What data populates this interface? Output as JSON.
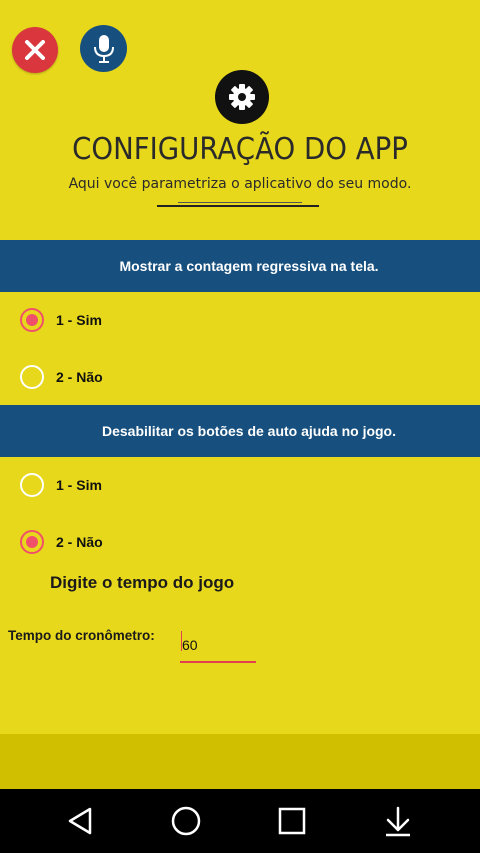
{
  "header": {
    "title": "CONFIGURAÇÃO DO APP",
    "subtitle": "Aqui você parametriza o aplicativo do seu modo."
  },
  "icons": {
    "close": "close-icon",
    "mic": "microphone-icon",
    "settings": "gear-icon"
  },
  "colors": {
    "background": "#e8d81c",
    "section_bar": "#17507e",
    "close_button": "#d9363d",
    "radio_checked": "#f0506a"
  },
  "sections": [
    {
      "heading": "Mostrar a contagem regressiva na tela.",
      "options": [
        {
          "label": "1 - Sim",
          "checked": true
        },
        {
          "label": "2 - Não",
          "checked": false
        }
      ]
    },
    {
      "heading": "Desabilitar os botões de auto ajuda no jogo.",
      "options": [
        {
          "label": "1 - Sim",
          "checked": false
        },
        {
          "label": "2 - Não",
          "checked": true
        }
      ]
    }
  ],
  "timer": {
    "heading": "Digite o tempo do jogo",
    "label": "Tempo do cronômetro:",
    "value": "60"
  },
  "navbar": [
    "back-icon",
    "home-icon",
    "recents-icon",
    "download-icon"
  ]
}
